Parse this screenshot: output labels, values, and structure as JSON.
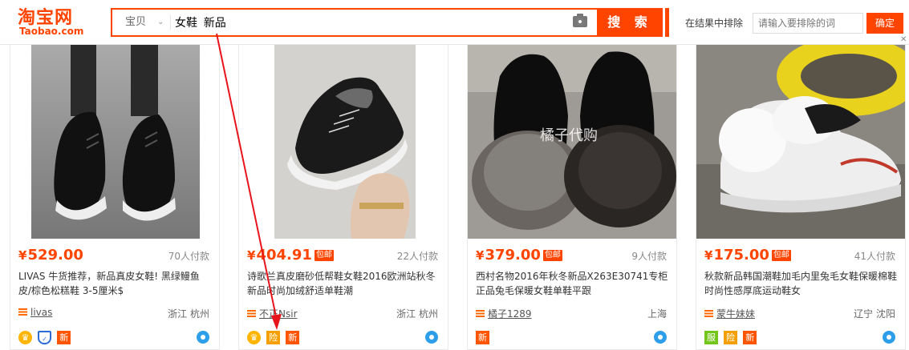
{
  "header": {
    "logo_cn": "淘宝网",
    "logo_en": "Taobao.com",
    "scope": "宝贝",
    "query": "女鞋  新品",
    "search_label": "搜 索",
    "exclude_label": "在结果中排除",
    "exclude_placeholder": "请输入要排除的词",
    "exclude_btn": "确定"
  },
  "products": [
    {
      "currency": "¥",
      "price": "529.00",
      "paid": "70人付款",
      "title": "LIVAS 牛货推荐，新品真皮女鞋! 黑绿鳗鱼皮/棕色松糕鞋 3-5厘米$",
      "shop": "livas",
      "location": "浙江 杭州",
      "tags": [
        "gold",
        "shield",
        "xin"
      ]
    },
    {
      "currency": "¥",
      "price": "404.91",
      "mail": "包邮",
      "paid": "22人付款",
      "title": "诗歌兰真皮磨砂低帮鞋女鞋2016欧洲站秋冬新品时尚加绒舒适单鞋潮",
      "shop": "不正Nsir",
      "location": "浙江 杭州",
      "tags": [
        "gold",
        "xian",
        "xin"
      ]
    },
    {
      "currency": "¥",
      "price": "379.00",
      "mail": "包邮",
      "paid": "9人付款",
      "title": "西村名物2016年秋冬新品X263E30741专柜正品兔毛保暖女鞋单鞋平跟",
      "shop": "橘子1289",
      "location": "上海",
      "watermark": "橘子代购",
      "tags": [
        "xin"
      ]
    },
    {
      "currency": "¥",
      "price": "175.00",
      "mail": "包邮",
      "paid": "41人付款",
      "title": "秋款新品韩国潮鞋加毛内里兔毛女鞋保暖棉鞋时尚性感厚底运动鞋女",
      "shop": "蒙牛妹妹",
      "location": "辽宁 沈阳",
      "tags": [
        "fu",
        "xian",
        "xin"
      ]
    }
  ],
  "tag_labels": {
    "xin": "新",
    "xian": "险",
    "fu": "服",
    "shield": "✓",
    "gold": "♛"
  },
  "colors": {
    "accent": "#ff4400",
    "annotation_arrow": "#e8141b"
  }
}
